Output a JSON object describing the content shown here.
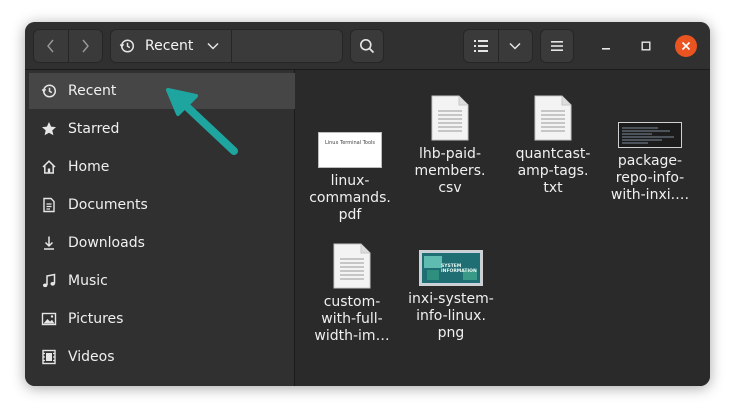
{
  "header": {
    "path_label": "Recent"
  },
  "sidebar": {
    "items": [
      {
        "label": "Recent",
        "icon": "clock-icon",
        "active": true
      },
      {
        "label": "Starred",
        "icon": "star-icon"
      },
      {
        "label": "Home",
        "icon": "home-icon"
      },
      {
        "label": "Documents",
        "icon": "document-icon"
      },
      {
        "label": "Downloads",
        "icon": "download-icon"
      },
      {
        "label": "Music",
        "icon": "music-icon"
      },
      {
        "label": "Pictures",
        "icon": "pictures-icon"
      },
      {
        "label": "Videos",
        "icon": "videos-icon"
      }
    ]
  },
  "files": [
    {
      "name": "linux-\ncommands.\npdf",
      "type": "pdf",
      "thumb_text": "Linux Terminal Tools"
    },
    {
      "name": "lhb-paid-\nmembers.\ncsv",
      "type": "csv"
    },
    {
      "name": "quantcast-\namp-tags.\ntxt",
      "type": "txt"
    },
    {
      "name": "package-\nrepo-info-\nwith-inxi.…",
      "type": "terminal-image"
    },
    {
      "name": "custom-\nwith-full-\nwidth-im…",
      "type": "text"
    },
    {
      "name": "inxi-system-\ninfo-linux.\npng",
      "type": "png",
      "thumb_text": "SYSTEM INFORMATION"
    }
  ],
  "colors": {
    "accent_close": "#e95420",
    "arrow": "#1fa5a0",
    "sidebar_bg": "#303030",
    "content_bg": "#2a2a2a"
  }
}
